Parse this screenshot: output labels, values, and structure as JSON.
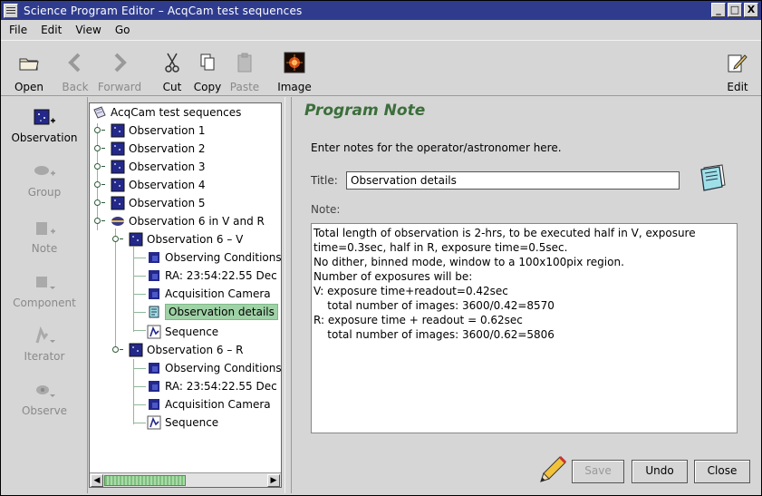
{
  "window": {
    "title": "Science Program Editor – AcqCam test sequences"
  },
  "window_buttons": [
    "_",
    "□",
    "X"
  ],
  "menu": [
    "File",
    "Edit",
    "View",
    "Go"
  ],
  "toolbar": {
    "open": "Open",
    "back": "Back",
    "forward": "Forward",
    "cut": "Cut",
    "copy": "Copy",
    "paste": "Paste",
    "image": "Image",
    "edit": "Edit"
  },
  "palette": {
    "observation": "Observation",
    "group": "Group",
    "note": "Note",
    "component": "Component",
    "iterator": "Iterator",
    "observe": "Observe"
  },
  "tree": {
    "root": "AcqCam test sequences",
    "items": [
      "Observation 1",
      "Observation 2",
      "Observation 3",
      "Observation 4",
      "Observation 5",
      "Observation 6 in V and R",
      "Observation 6 – V",
      "Observing Conditions",
      "RA: 23:54:22.55 Dec",
      "Acquisition Camera",
      "Observation details",
      "Sequence",
      "Observation 6 – R",
      "Observing Conditions",
      "RA: 23:54:22.55 Dec",
      "Acquisition Camera",
      "Sequence"
    ],
    "selected_index": 10
  },
  "program_note": {
    "heading": "Program Note",
    "instructions": "Enter notes for the operator/astronomer here.",
    "title_label": "Title:",
    "title_value": "Observation details",
    "note_label": "Note:",
    "note_text": "Total length of observation is 2-hrs, to be executed half in V, exposure\ntime=0.3sec, half in R, exposure time=0.5sec.\nNo dither, binned mode, window to a 100x100pix region.\nNumber of exposures will be:\nV: exposure time+readout=0.42sec\n    total number of images: 3600/0.42=8570\nR: exposure time + readout = 0.62sec\n    total number of images: 3600/0.62=5806"
  },
  "buttons": {
    "save": "Save",
    "undo": "Undo",
    "close": "Close"
  },
  "colors": {
    "titlebar": "#2f3c8e",
    "heading": "#3b6e3b",
    "selection": "#9fd2a6"
  }
}
